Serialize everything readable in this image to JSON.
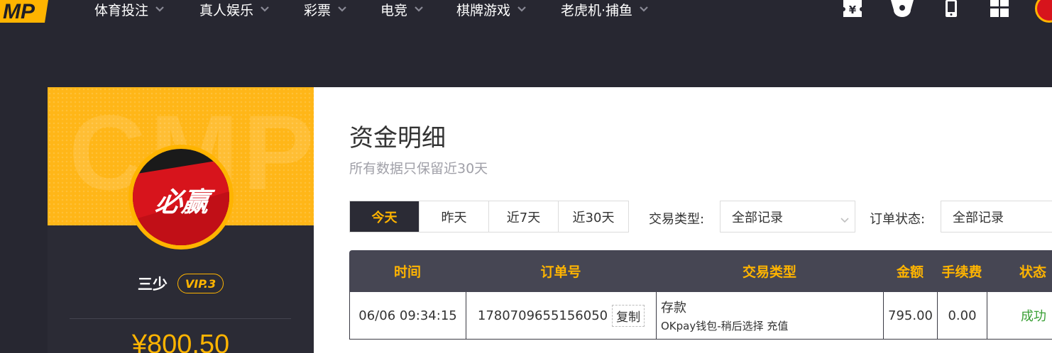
{
  "nav": {
    "logo_text": "MP",
    "items": [
      {
        "label": "体育投注"
      },
      {
        "label": "真人娱乐"
      },
      {
        "label": "彩票"
      },
      {
        "label": "电竞"
      },
      {
        "label": "棋牌游戏"
      },
      {
        "label": "老虎机·捕鱼"
      }
    ],
    "icons": [
      "yuan-ticket-icon",
      "gift-icon",
      "mobile-icon",
      "grid-icon"
    ]
  },
  "profile": {
    "banner_watermark": "CMP",
    "avatar_text": "必赢",
    "username": "三少",
    "vip": "VIP.3",
    "balance": "¥800.50"
  },
  "page": {
    "title": "资金明细",
    "subtitle": "所有数据只保留近30天"
  },
  "tabs": [
    {
      "label": "今天",
      "active": true
    },
    {
      "label": "昨天",
      "active": false
    },
    {
      "label": "近7天",
      "active": false
    },
    {
      "label": "近30天",
      "active": false
    }
  ],
  "filters": {
    "type_label": "交易类型:",
    "type_value": "全部记录",
    "status_label": "订单状态:",
    "status_value": "全部记录"
  },
  "table": {
    "headers": [
      "时间",
      "订单号",
      "交易类型",
      "金额",
      "手续费",
      "状态"
    ],
    "rows": [
      {
        "time": "06/06 09:34:15",
        "order_no": "1780709655156050",
        "copy_label": "复制",
        "type": "存款",
        "type_detail": "OKpay钱包-稍后选择 充值",
        "amount": "795.00",
        "fee": "0.00",
        "status": "成功"
      }
    ]
  },
  "colors": {
    "accent": "#ffb400",
    "dark_bg": "#272731",
    "header_bg": "#464653",
    "success": "#3aa035",
    "brand_red": "#d7141c"
  }
}
